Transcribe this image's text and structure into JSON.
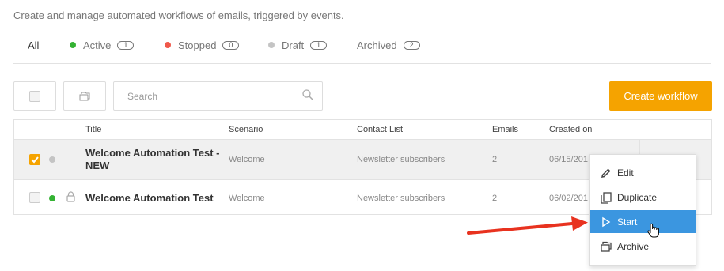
{
  "header": {
    "subtitle": "Create and manage automated workflows of emails, triggered by events."
  },
  "tabs": [
    {
      "label": "All",
      "active": true
    },
    {
      "label": "Active",
      "count": "1",
      "dot_color": "#34b233"
    },
    {
      "label": "Stopped",
      "count": "0",
      "dot_color": "#f0584a"
    },
    {
      "label": "Draft",
      "count": "1",
      "dot_color": "#c4c4c4"
    },
    {
      "label": "Archived",
      "count": "2"
    }
  ],
  "toolbar": {
    "search_placeholder": "Search",
    "create_label": "Create workflow",
    "create_color": "#f5a300"
  },
  "table": {
    "columns": [
      "Title",
      "Scenario",
      "Contact List",
      "Emails",
      "Created on"
    ],
    "rows": [
      {
        "selected": true,
        "status_color": "#c4c4c4",
        "title": "Welcome Automation Test - NEW",
        "title_line1": "Welcome Automation Test -",
        "title_line2": "NEW",
        "scenario": "Welcome",
        "contact_list": "Newsletter subscribers",
        "emails": "2",
        "created_on": "06/15/201"
      },
      {
        "selected": false,
        "locked": true,
        "status_color": "#34b233",
        "title": "Welcome Automation Test",
        "scenario": "Welcome",
        "contact_list": "Newsletter subscribers",
        "emails": "2",
        "created_on": "06/02/201"
      }
    ]
  },
  "context_menu": {
    "items": [
      {
        "label": "Edit",
        "icon": "pencil-icon"
      },
      {
        "label": "Duplicate",
        "icon": "copy-icon"
      },
      {
        "label": "Start",
        "icon": "play-icon",
        "highlighted": true
      },
      {
        "label": "Archive",
        "icon": "archive-icon"
      }
    ],
    "highlight_color": "#3b96e0"
  },
  "annotation": {
    "arrow_color": "#e8321f"
  }
}
